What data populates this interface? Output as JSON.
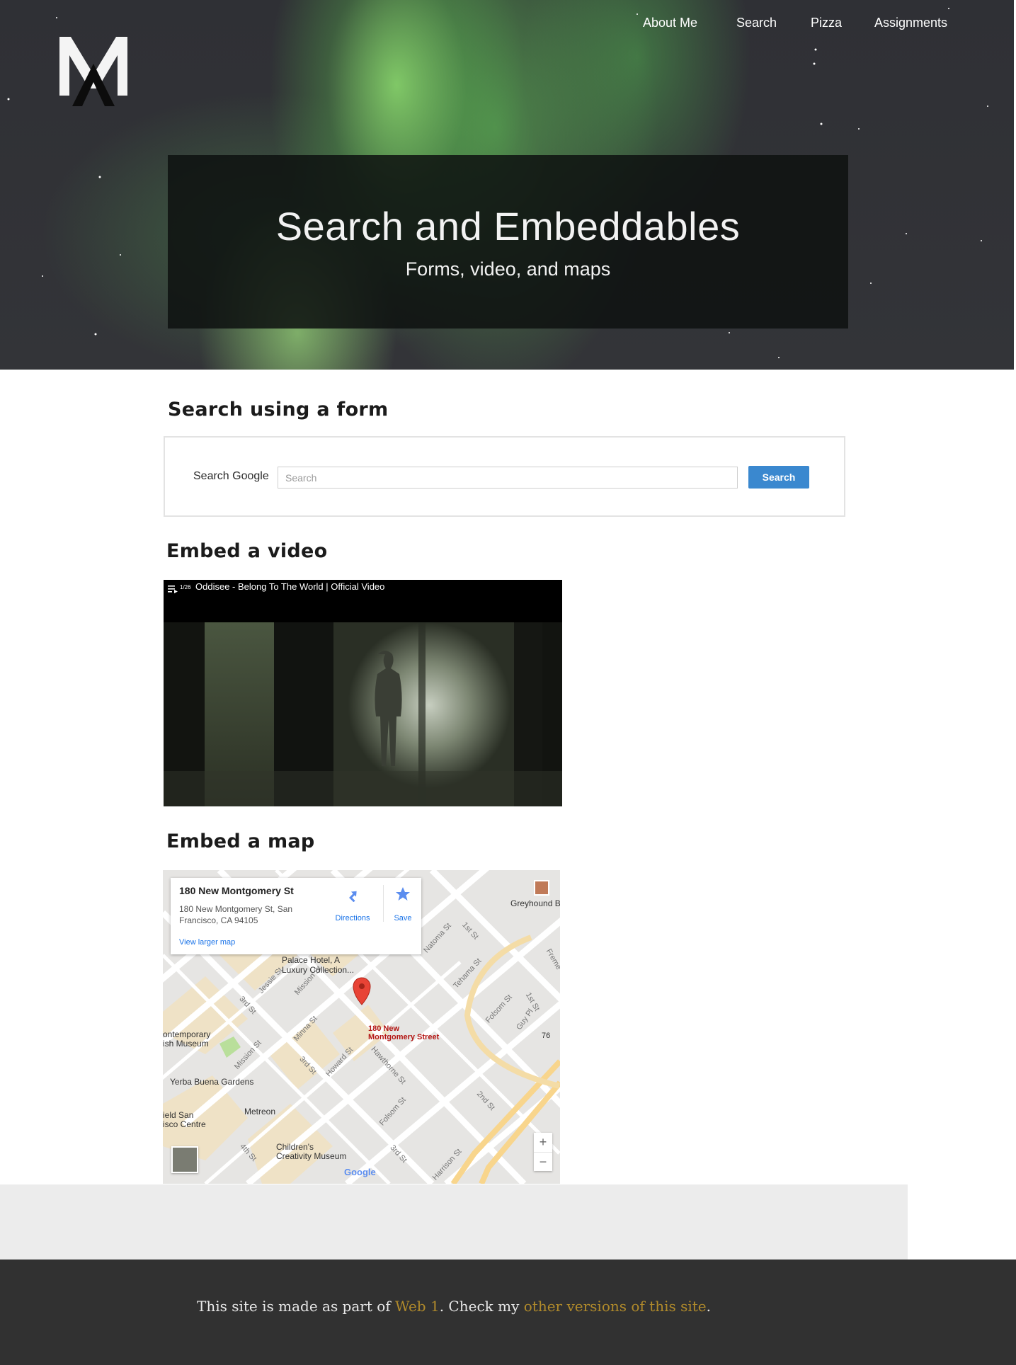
{
  "nav": {
    "items": [
      {
        "label": "About Me"
      },
      {
        "label": "Search"
      },
      {
        "label": "Pizza"
      },
      {
        "label": "Assignments"
      }
    ]
  },
  "hero": {
    "title": "Search and Embeddables",
    "subtitle": "Forms, video, and maps"
  },
  "search_section": {
    "heading": "Search using a form",
    "label": "Search Google",
    "placeholder": "Search",
    "button_label": "Search"
  },
  "video_section": {
    "heading": "Embed a video",
    "playlist_count": "1/26",
    "video_title": "Oddisee - Belong To The World | Official Video"
  },
  "map_section": {
    "heading": "Embed a map",
    "card_title": "180 New Montgomery St",
    "card_address": "180 New Montgomery St, San Francisco, CA 94105",
    "directions_label": "Directions",
    "save_label": "Save",
    "larger_map_label": "View larger map",
    "marker_label": "180 New\nMontgomery Street",
    "labels": {
      "greyhound": "Greyhound B",
      "palace": "Palace Hotel, A",
      "luxury": "Luxury Collection...",
      "contemporary": "ontemporary\nish Museum",
      "yerba": "Yerba Buena Gardens",
      "metreon": "Metreon",
      "yerba_center": "ield San\nisco Centre",
      "childrens": "Children's\nCreativity Museum",
      "google": "Google",
      "num76": "76"
    },
    "streets": {
      "natoma": "Natoma St",
      "first": "1st St",
      "tehama": "Tehama St",
      "folsom1": "Folsom St",
      "first2": "1st St",
      "guy": "Guy Pl",
      "jessie": "Jessie St",
      "third1": "3rd St",
      "mission1": "Mission St",
      "minna": "Minna St",
      "mission2": "Mission St",
      "third2": "3rd St",
      "howard": "Howard St",
      "hawthorne": "Hawthorne St",
      "second": "2nd St",
      "folsom2": "Folsom St",
      "fourth": "4th St",
      "third3": "3rd St",
      "harrison": "Harrison St",
      "freme": "Freme"
    },
    "zoom_in": "+",
    "zoom_out": "−"
  },
  "footer": {
    "text_before": "This site is made as part of ",
    "link1": "Web 1",
    "text_middle": ". Check my ",
    "link2": "other versions of this site",
    "text_after": "."
  },
  "colors": {
    "accent_blue": "#3a88cf",
    "footer_link": "#b08a2b",
    "footer_bg": "#313131",
    "map_pin": "#e84335"
  }
}
